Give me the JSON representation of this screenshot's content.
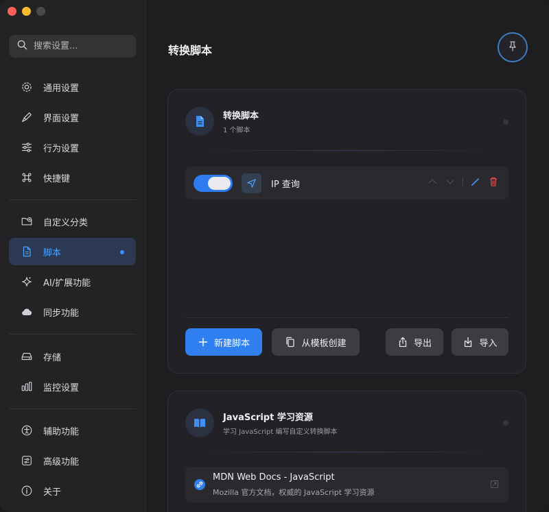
{
  "search": {
    "placeholder": "搜索设置..."
  },
  "sidebar": {
    "items": [
      {
        "label": "通用设置",
        "icon": "gear-icon"
      },
      {
        "label": "界面设置",
        "icon": "brush-icon"
      },
      {
        "label": "行为设置",
        "icon": "sliders-icon"
      },
      {
        "label": "快捷键",
        "icon": "command-icon"
      },
      {
        "label": "自定义分类",
        "icon": "folder-plus-icon"
      },
      {
        "label": "脚本",
        "icon": "document-icon",
        "active": true
      },
      {
        "label": "AI/扩展功能",
        "icon": "sparkles-icon"
      },
      {
        "label": "同步功能",
        "icon": "cloud-icon"
      },
      {
        "label": "存储",
        "icon": "drive-icon"
      },
      {
        "label": "监控设置",
        "icon": "bars-icon"
      },
      {
        "label": "辅助功能",
        "icon": "accessibility-icon"
      },
      {
        "label": "高级功能",
        "icon": "advanced-icon"
      },
      {
        "label": "关于",
        "icon": "info-icon"
      }
    ]
  },
  "header": {
    "title": "转换脚本",
    "pin_icon": "pin-icon"
  },
  "scripts_card": {
    "title": "转换脚本",
    "subtitle": "1 个脚本",
    "scripts": [
      {
        "name": "IP 查询",
        "enabled": true,
        "icon": "location-arrow-icon"
      }
    ],
    "buttons": {
      "new": "新建脚本",
      "from_template": "从模板创建",
      "export": "导出",
      "import": "导入"
    }
  },
  "resources_card": {
    "title": "JavaScript 学习资源",
    "subtitle": "学习 JavaScript 编写自定义转换脚本",
    "links": [
      {
        "title": "MDN Web Docs - JavaScript",
        "desc": "Mozilla 官方文档，权威的 JavaScript 学习资源"
      }
    ]
  },
  "colors": {
    "accent": "#2f7ff0",
    "active_nav_bg": "#2b3a52",
    "delete": "#e0484a",
    "background": "#1e1e20"
  }
}
